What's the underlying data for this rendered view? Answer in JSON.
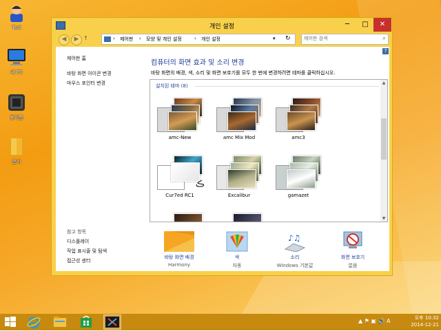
{
  "desktop": {
    "icons": [
      {
        "label": "Test",
        "icon": "user-icon"
      },
      {
        "label": "내 PC",
        "icon": "computer-icon"
      },
      {
        "label": "휴지통",
        "icon": "recycle-bin-icon"
      },
      {
        "label": "문서",
        "icon": "folder-icon"
      }
    ]
  },
  "window": {
    "title": "개인 설정",
    "controls": {
      "minimize": "─",
      "maximize": "□",
      "close": "✕"
    }
  },
  "address": {
    "crumbs": [
      "제어판",
      "모양 및 개인 설정",
      "개인 설정"
    ],
    "separator": "›",
    "dropdown": "▾",
    "refresh": "↻"
  },
  "search": {
    "placeholder": "제어판 검색",
    "value": ""
  },
  "help": "?",
  "sidebar": {
    "home": "제어판 홈",
    "links": [
      "바탕 화면 아이콘 변경",
      "마우스 포인터 변경"
    ],
    "see_also_title": "참고 항목",
    "see_also": [
      "디스플레이",
      "작업 표시줄 및 탐색",
      "접근성 센터"
    ]
  },
  "main": {
    "title": "컴퓨터의 화면 효과 및 소리 변경",
    "description": "바탕 화면의 배경, 색, 소리 및 화면 보호기를 모두 한 번에 변경하려면 테마를 클릭하십시오."
  },
  "themes": {
    "group_title": "설치된 테마 (8)",
    "items": [
      {
        "name": "amc-New"
      },
      {
        "name": "amc Mix Mod"
      },
      {
        "name": "amc3"
      },
      {
        "name": "Cur7ed RC1"
      },
      {
        "name": "Excalibur"
      },
      {
        "name": "gamazet"
      }
    ]
  },
  "options": [
    {
      "label": "바탕 화면 배경",
      "value": "Harmony",
      "icon": "desktop-background-icon"
    },
    {
      "label": "색",
      "value": "자동",
      "icon": "color-icon"
    },
    {
      "label": "소리",
      "value": "Windows 기본값",
      "icon": "sound-icon"
    },
    {
      "label": "화면 보호기",
      "value": "없음",
      "icon": "screensaver-icon"
    }
  ],
  "taskbar": {
    "apps": [
      "start-icon",
      "internet-explorer-icon",
      "file-explorer-icon",
      "store-icon",
      "settings-app-icon"
    ],
    "tray_symbols": "▲ ⚑ ▣ 🔊 A",
    "time": "오후 10:32",
    "date": "2014-12-21"
  },
  "colors": {
    "accent": "#f8d04b",
    "link": "#1f3e99",
    "close": "#c7312b",
    "taskbar": "#c68a10"
  }
}
